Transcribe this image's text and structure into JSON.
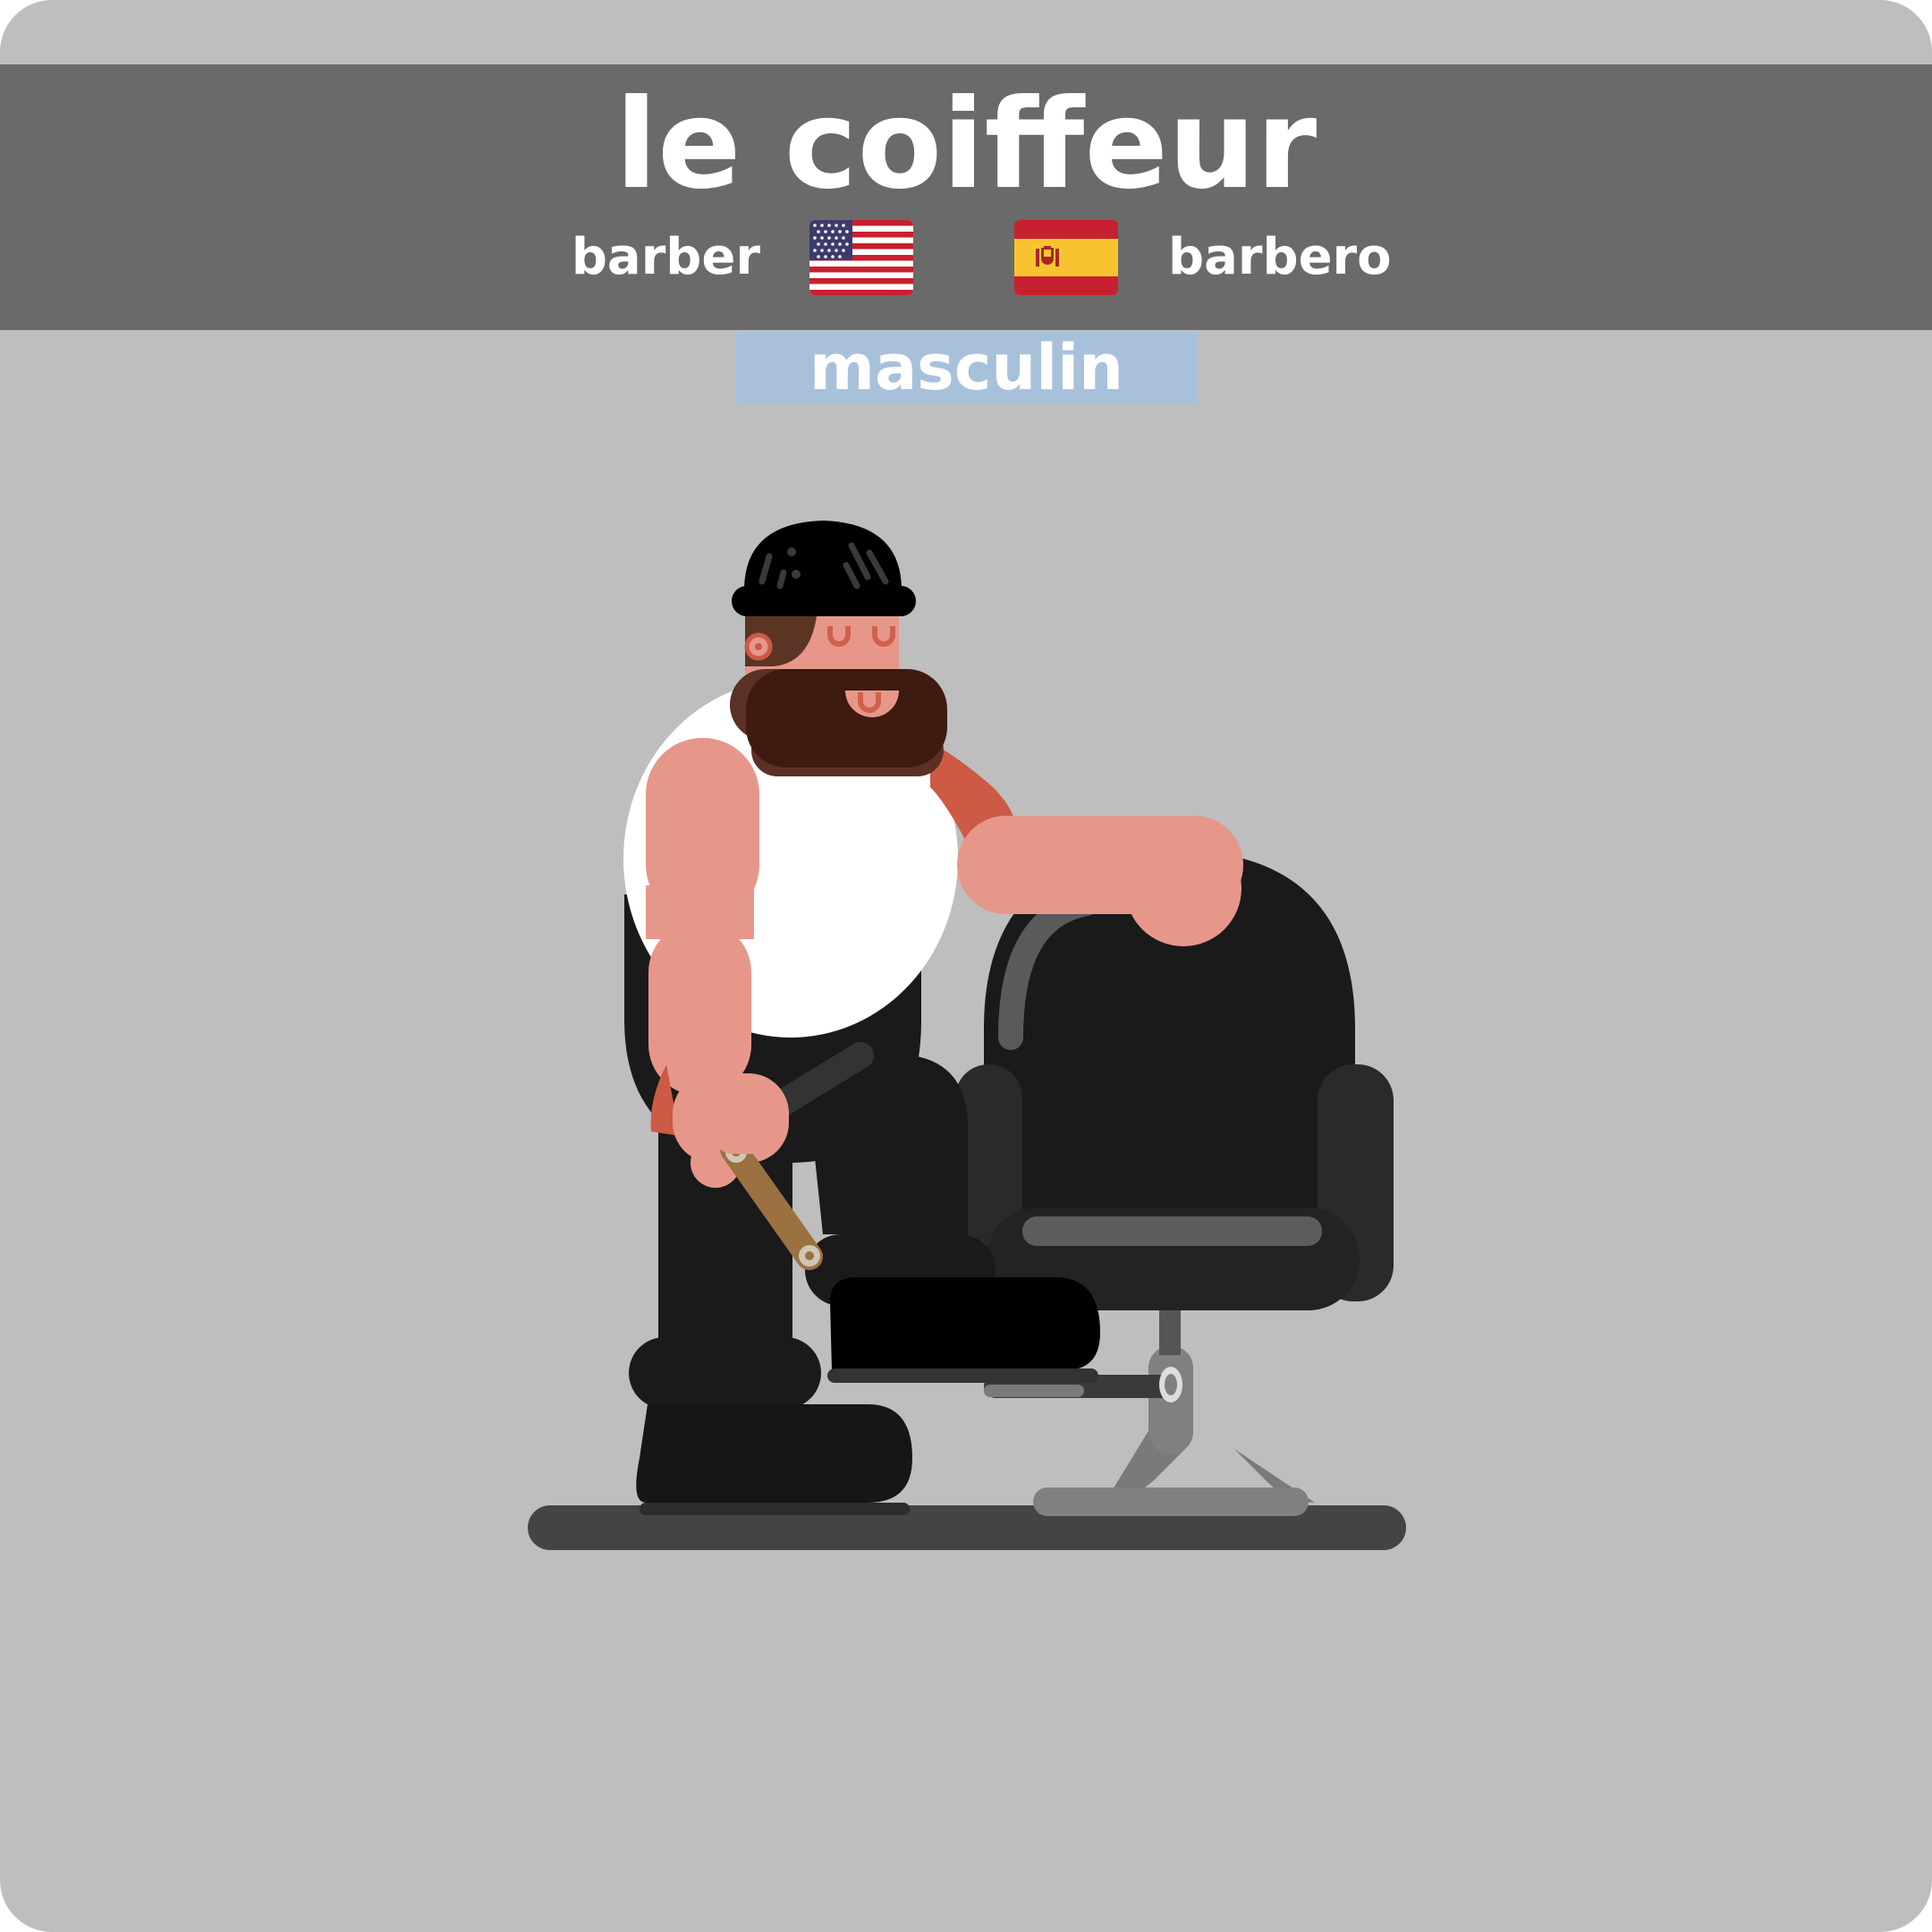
{
  "card": {
    "word": "le coiffeur",
    "english": "barber",
    "spanish": "barbero",
    "gender": "masculin"
  },
  "colors": {
    "card_background": "#bebebe",
    "header_background": "#6a6a6a",
    "gender_badge": "#a8c1db",
    "text": "#ffffff"
  },
  "icons": {
    "english_flag": "us-flag-icon",
    "spanish_flag": "spain-flag-icon"
  },
  "illustration": "barber-illustration"
}
